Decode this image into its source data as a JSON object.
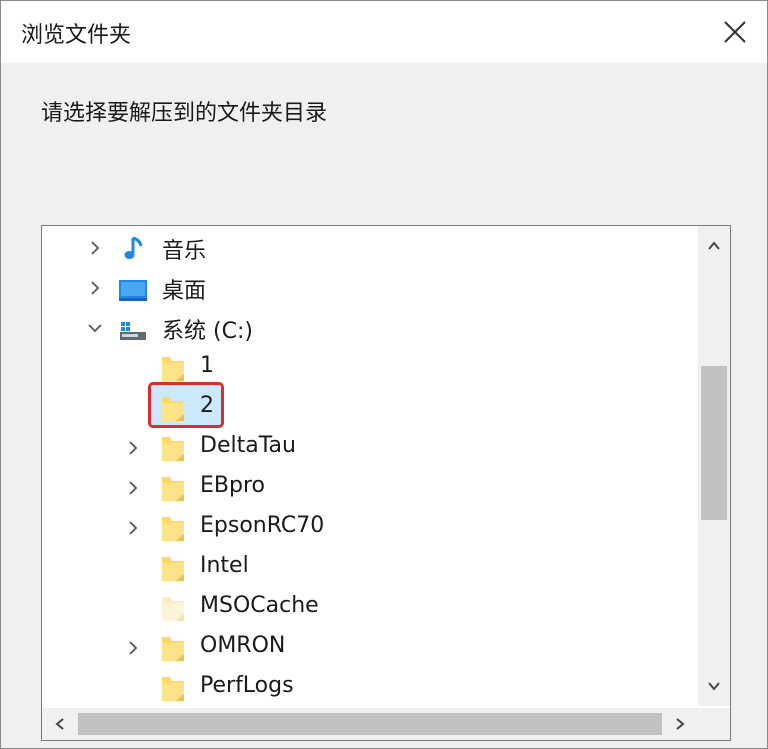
{
  "window": {
    "title": "浏览文件夹",
    "close_icon": "close-icon"
  },
  "prompt": "请选择要解压到的文件夹目录",
  "tree": {
    "nodes": [
      {
        "label": "音乐",
        "icon": "music-note-icon",
        "expander": "collapsed"
      },
      {
        "label": "桌面",
        "icon": "desktop-icon",
        "expander": "collapsed"
      },
      {
        "label": "系统 (C:)",
        "icon": "drive-icon",
        "expander": "expanded"
      },
      {
        "label": "1",
        "icon": "folder-icon",
        "expander": "none"
      },
      {
        "label": "2",
        "icon": "folder-icon",
        "expander": "none",
        "selected": true
      },
      {
        "label": "DeltaTau",
        "icon": "folder-icon",
        "expander": "collapsed"
      },
      {
        "label": "EBpro",
        "icon": "folder-icon",
        "expander": "collapsed"
      },
      {
        "label": "EpsonRC70",
        "icon": "folder-icon",
        "expander": "collapsed"
      },
      {
        "label": "Intel",
        "icon": "folder-icon",
        "expander": "none"
      },
      {
        "label": "MSOCache",
        "icon": "folder-icon",
        "expander": "none",
        "faded": true
      },
      {
        "label": "OMRON",
        "icon": "folder-icon",
        "expander": "collapsed"
      },
      {
        "label": "PerfLogs",
        "icon": "folder-icon",
        "expander": "none"
      }
    ]
  },
  "colors": {
    "selection": "#cce8ff",
    "highlight_border": "#d62f2f",
    "folder": "#ffd966"
  }
}
